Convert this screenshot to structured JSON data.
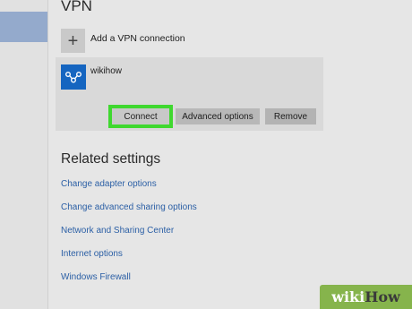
{
  "page": {
    "title": "VPN"
  },
  "add_vpn": {
    "icon": "plus-icon",
    "label": "Add a VPN connection"
  },
  "connection": {
    "icon": "vpn-network-icon",
    "name": "wikihow",
    "buttons": {
      "connect": "Connect",
      "advanced": "Advanced options",
      "remove": "Remove"
    }
  },
  "related": {
    "heading": "Related settings",
    "links": [
      "Change adapter options",
      "Change advanced sharing options",
      "Network and Sharing Center",
      "Internet options",
      "Windows Firewall"
    ]
  },
  "watermark": {
    "part1": "wiki",
    "part2": "How"
  },
  "colors": {
    "accent_blue": "#1565c0",
    "link_blue": "#2b5fa5",
    "highlight_green": "#3fd82f",
    "sidebar_selection": "#94aacc"
  }
}
